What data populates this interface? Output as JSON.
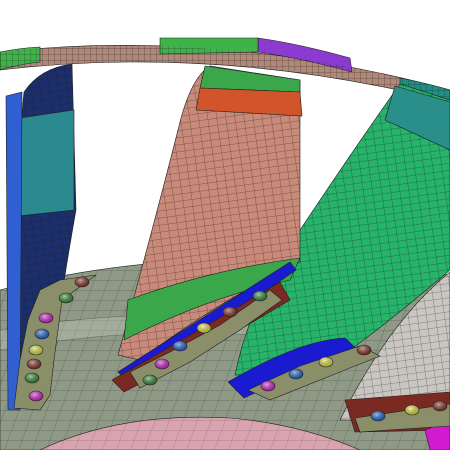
{
  "scene": {
    "subject": "finite-element-mesh-impeller",
    "palette": {
      "background": "#ffffff",
      "hub_mesh": "#8f9a86",
      "hub_highlight": "#c8cfc0",
      "hub_pink_region": "#d9a3b0",
      "mesh_line": "#1f1f1f",
      "shroud_mesh": "#b08878",
      "shroud_green": "#3fb34a",
      "shroud_purple": "#8b3bd0",
      "shroud_teal": "#1f8f86",
      "blade_left_navy": "#1d2f6b",
      "blade_left_teal": "#2a8a8f",
      "blade_left_blue": "#2f5fd0",
      "blade_mid_salmon": "#c98a7a",
      "blade_mid_orange": "#d2542a",
      "blade_mid_green": "#3aa84a",
      "blade_right_green": "#27b36a",
      "blade_right_teal": "#2a8f8a",
      "blade_far_gray": "#c9c6c2",
      "blade_root_blue": "#1a1ad0",
      "blade_root_brown": "#7a2a20",
      "blade_root_magenta": "#d21ad0",
      "bolt_flange": "#8a8f6a",
      "bolt_colors": [
        "#8a3a2a",
        "#3a8f3a",
        "#d22ad0",
        "#2a6ad0",
        "#e0e04a"
      ]
    }
  }
}
